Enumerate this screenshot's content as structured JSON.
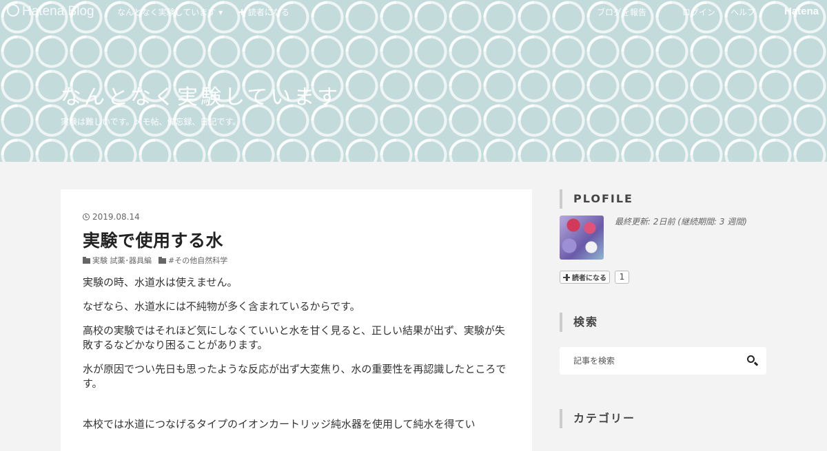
{
  "globalbar": {
    "logo": "Hatena Blog",
    "blog_name": "なんとなく実験しています ▾",
    "readme": "✚ 読者になる",
    "report": "ブログを報告",
    "login": "ログイン",
    "help": "ヘルプ",
    "hatena": "Hatena"
  },
  "blog": {
    "title": "なんとなく実験しています",
    "description": "実験は難しいです。メモ帖、備忘録、日記です。"
  },
  "article": {
    "date": "2019.08.14",
    "title": "実験で使用する水",
    "categories": [
      "実験 試薬･器具編",
      "#その他自然科学"
    ],
    "paragraphs": [
      "実験の時、水道水は使えません。",
      "なぜなら、水道水には不純物が多く含まれているからです。",
      "高校の実験ではそれほど気にしなくていいと水を甘く見ると、正しい結果が出ず、実験が失敗するなどかなり困ることがあります。",
      "水が原因でつい先日も思ったような反応が出ず大変焦り、水の重要性を再認識したところです。",
      "本校では水道につなげるタイプのイオンカートリッジ純水器を使用して純水を得てい"
    ]
  },
  "sidebar": {
    "profile_heading": "PLOFILE",
    "profile_updated": "最終更新: 2日前 (継続期間: 3 週間)",
    "subscribe_label": "読者になる",
    "subscribe_count": "1",
    "search_heading": "検索",
    "search_placeholder": "記事を検索",
    "categories_heading": "カテゴリー"
  },
  "colors": {
    "header_bg": "#c4dbdc",
    "page_bg": "#f3f3f3"
  }
}
